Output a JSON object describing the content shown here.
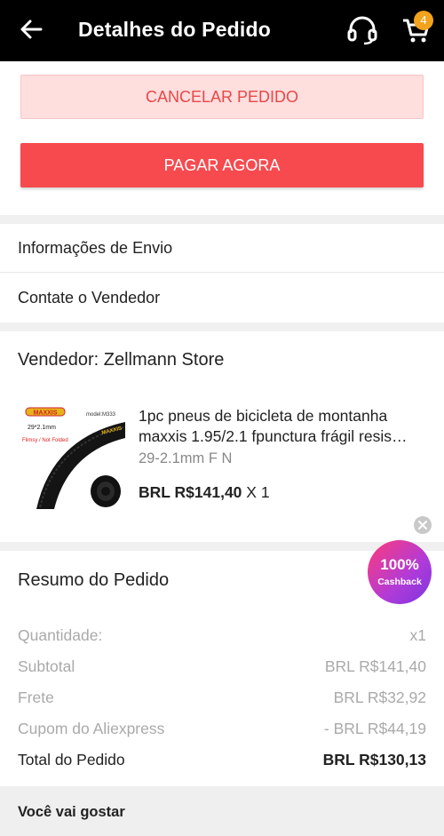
{
  "header": {
    "title": "Detalhes do Pedido",
    "cart_count": "4",
    "colors": {
      "bar": "#000000",
      "badge": "#f2a21c"
    }
  },
  "actions": {
    "cancel_label": "CANCELAR PEDIDO",
    "pay_label": "PAGAR AGORA",
    "colors": {
      "cancel_bg": "#ffdede",
      "cancel_text": "#e94747",
      "pay_bg": "#f74a4f"
    }
  },
  "links": {
    "shipping_info": "Informações de Envio",
    "contact_seller": "Contate o Vendedor"
  },
  "seller": {
    "vendor_label": "Vendedor: Zellmann Store",
    "product": {
      "title_line1": "1pc pneus de bicicleta de montanha",
      "title_line2": "maxxis 1.95/2.1 fpunctura frágil resis…",
      "variant": "29-2.1mm F N",
      "price": "BRL R$141,40",
      "quantity": "X 1",
      "image_labels": {
        "brand": "MAXXIS",
        "model": "model:M333",
        "size": "29*2.1mm",
        "type": "Flimsy / Not Folded"
      }
    }
  },
  "cashback": {
    "percent": "100%",
    "label": "Cashback"
  },
  "summary": {
    "title": "Resumo do Pedido",
    "rows": [
      {
        "label": "Quantidade:",
        "value": "x1"
      },
      {
        "label": "Subtotal",
        "value": "BRL R$141,40"
      },
      {
        "label": "Frete",
        "value": "BRL R$32,92"
      },
      {
        "label": "Cupom do Aliexpress",
        "value": "- BRL R$44,19"
      }
    ],
    "total": {
      "label": "Total do Pedido",
      "value": "BRL R$130,13"
    }
  },
  "suggestions": {
    "title": "Você vai gostar"
  },
  "icons": [
    "back-arrow-icon",
    "headset-icon",
    "cart-icon",
    "close-icon"
  ]
}
